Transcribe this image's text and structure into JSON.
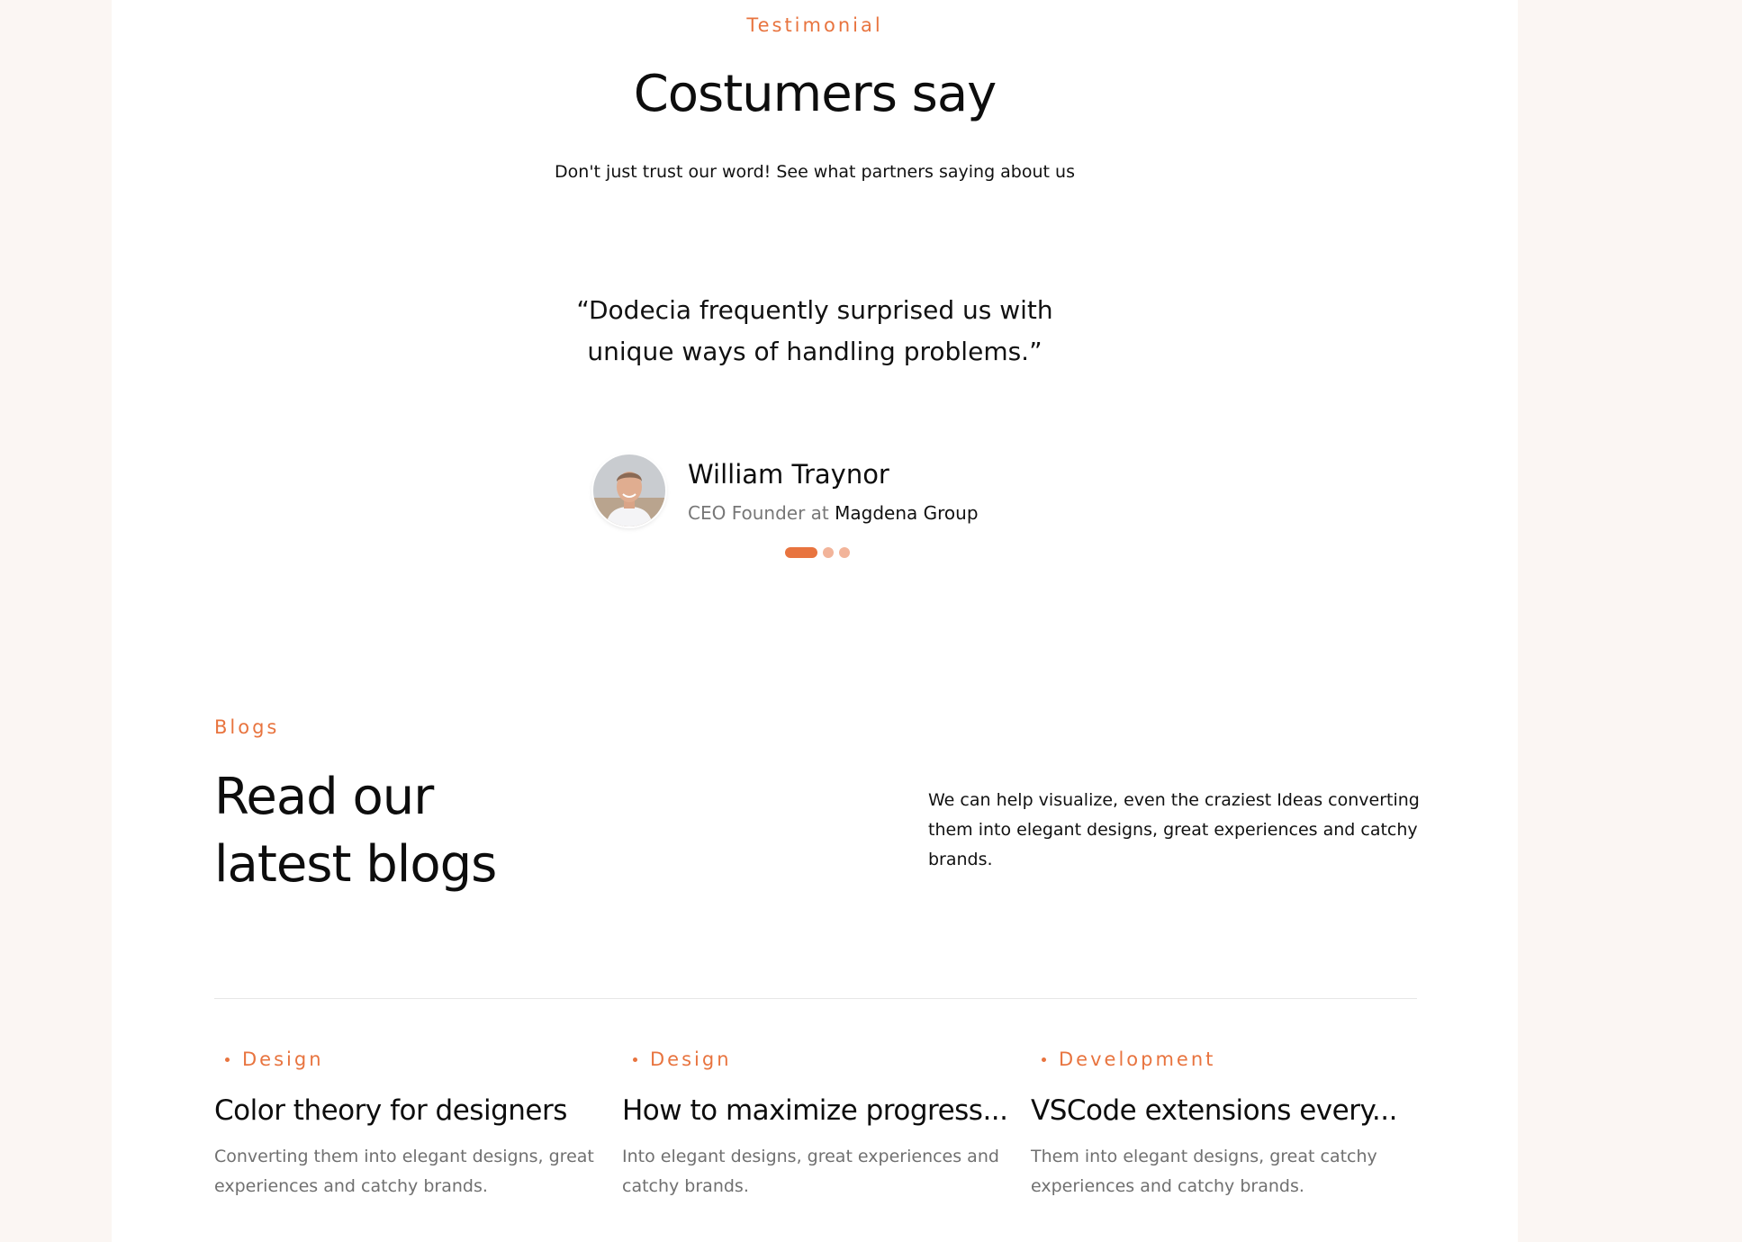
{
  "testimonial": {
    "eyebrow": "Testimonial",
    "title": "Costumers say",
    "subtitle": "Don't just trust our word! See what partners saying about us",
    "quote": "“Dodecia frequently surprised us with unique ways of handling problems.”",
    "author": {
      "name": "William Traynor",
      "role_prefix": "CEO Founder at",
      "company": "Magdena Group"
    },
    "pagination": {
      "count": 3,
      "active_index": 0
    }
  },
  "blogs": {
    "eyebrow": "Blogs",
    "title_line1": "Read our",
    "title_line2": "latest blogs",
    "description": "We can help visualize, even the craziest Ideas converting them into elegant designs, great experiences and catchy brands.",
    "posts": [
      {
        "category": "Design",
        "title": "Color theory for designers",
        "excerpt": "Converting them into elegant designs, great experiences and catchy brands."
      },
      {
        "category": "Design",
        "title": "How to maximize progress...",
        "excerpt": "Into elegant designs, great experiences and catchy brands."
      },
      {
        "category": "Development",
        "title": "VSCode extensions every...",
        "excerpt": "Them into elegant designs, great catchy experiences and catchy brands."
      }
    ]
  },
  "colors": {
    "accent": "#e8743f",
    "accent_light": "#f2b49a",
    "background": "#fbf6f3",
    "panel": "#ffffff"
  }
}
